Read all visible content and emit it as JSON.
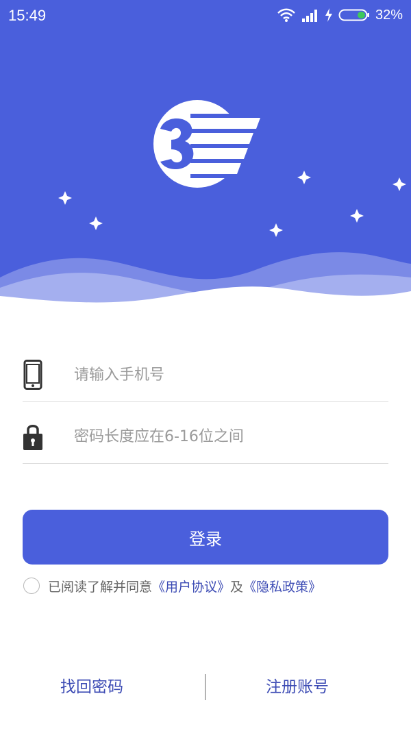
{
  "status_bar": {
    "time": "15:49",
    "battery_percent": "32%",
    "icons": [
      "wifi-icon",
      "signal-icon",
      "charging-icon",
      "battery-icon"
    ]
  },
  "colors": {
    "brand": "#4a5fdc",
    "link": "#3c4bb4",
    "hint": "#9a9a9a"
  },
  "form": {
    "phone_placeholder": "请输入手机号",
    "password_placeholder": "密码长度应在6-16位之间",
    "login_label": "登录"
  },
  "agreement": {
    "prefix": "已阅读了解并同意",
    "user_agreement": "《用户协议》",
    "conjunction": "及",
    "privacy_policy": "《隐私政策》",
    "checked": false
  },
  "footer": {
    "forgot_password": "找回密码",
    "register": "注册账号"
  }
}
